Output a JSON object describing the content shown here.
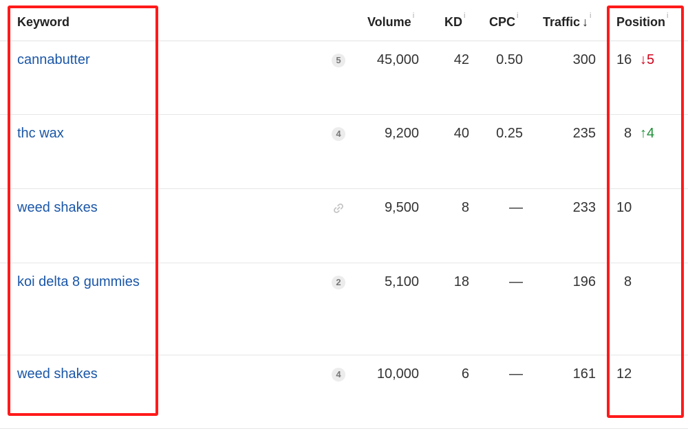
{
  "columns": {
    "keyword": "Keyword",
    "volume": "Volume",
    "kd": "KD",
    "cpc": "CPC",
    "traffic": "Traffic",
    "position": "Position",
    "info_mark": "i",
    "sort_arrow": "↓"
  },
  "rows": [
    {
      "keyword": "cannabutter",
      "badge": "5",
      "badge_type": "count",
      "volume": "45,000",
      "kd": "42",
      "cpc": "0.50",
      "traffic": "300",
      "position": "16",
      "change": "↓5",
      "change_dir": "down"
    },
    {
      "keyword": "thc wax",
      "badge": "4",
      "badge_type": "count",
      "volume": "9,200",
      "kd": "40",
      "cpc": "0.25",
      "traffic": "235",
      "position": "8",
      "change": "↑4",
      "change_dir": "up"
    },
    {
      "keyword": "weed shakes",
      "badge": "",
      "badge_type": "link-icon",
      "volume": "9,500",
      "kd": "8",
      "cpc": "—",
      "traffic": "233",
      "position": "10",
      "change": "",
      "change_dir": ""
    },
    {
      "keyword": "koi delta 8 gummies",
      "badge": "2",
      "badge_type": "count",
      "volume": "5,100",
      "kd": "18",
      "cpc": "—",
      "traffic": "196",
      "position": "8",
      "change": "",
      "change_dir": ""
    },
    {
      "keyword": "weed shakes",
      "badge": "4",
      "badge_type": "count",
      "volume": "10,000",
      "kd": "6",
      "cpc": "—",
      "traffic": "161",
      "position": "12",
      "change": "",
      "change_dir": ""
    }
  ],
  "colors": {
    "keyword_link": "#1a56a7",
    "highlight": "#ff1a1a",
    "change_down": "#d0021b",
    "change_up": "#1e8f35"
  }
}
